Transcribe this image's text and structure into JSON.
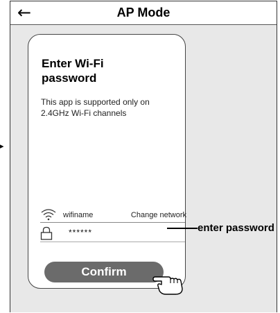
{
  "header": {
    "title": "AP Mode",
    "back_icon": "back-arrow-icon"
  },
  "card": {
    "title": "Enter Wi-Fi password",
    "subtitle": "This app is supported only on 2.4GHz Wi-Fi channels",
    "wifi": {
      "icon": "wifi-icon",
      "name": "wifiname",
      "change_label": "Change network"
    },
    "password": {
      "icon": "lock-icon",
      "value": "******"
    },
    "confirm_label": "Confirm"
  },
  "annotation": {
    "label": "enter password"
  }
}
